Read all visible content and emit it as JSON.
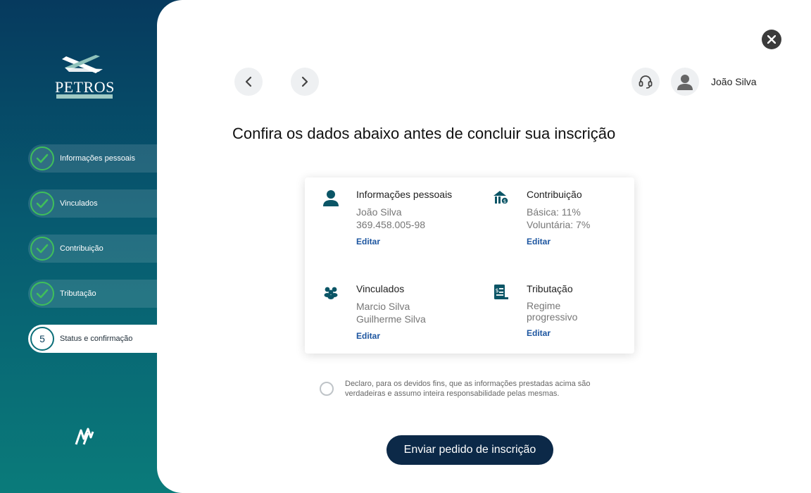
{
  "brand": {
    "logo_text": "PETROS"
  },
  "steps": [
    {
      "label": "Informações pessoais",
      "state": "done"
    },
    {
      "label": "Vinculados",
      "state": "done"
    },
    {
      "label": "Contribuição",
      "state": "done"
    },
    {
      "label": "Tributação",
      "state": "done"
    },
    {
      "label": "Status e confirmação",
      "state": "active",
      "number": "5"
    }
  ],
  "header": {
    "user_name": "João Silva",
    "icons": [
      "chevron-left-icon",
      "chevron-right-icon",
      "headset-icon",
      "user-icon",
      "close-icon"
    ]
  },
  "page": {
    "title": "Confira os dados abaixo antes de concluir sua inscrição"
  },
  "summary": {
    "personal": {
      "title": "Informações pessoais",
      "name": "João Silva",
      "cpf": "369.458.005-98",
      "edit": "Editar"
    },
    "contribution": {
      "title": "Contribuição",
      "basic": "Básica: 11%",
      "voluntary": "Voluntária: 7%",
      "edit": "Editar"
    },
    "linked": {
      "title": "Vinculados",
      "person1": "Marcio Silva",
      "person2": "Guilherme Silva",
      "edit": "Editar"
    },
    "taxation": {
      "title": "Tributação",
      "regime": "Regime progressivo",
      "edit": "Editar"
    }
  },
  "declaration": {
    "text": "Declaro, para os devidos fins, que as informações prestadas acima são verdadeiras e assumo inteira responsabilidade pelas mesmas.",
    "checked": false
  },
  "submit": {
    "label": "Enviar pedido de inscrição"
  },
  "colors": {
    "accent_green": "#3fbf5a",
    "primary_dark": "#0c2948",
    "link_blue": "#1d56a0",
    "icon_teal": "#0b5566"
  }
}
